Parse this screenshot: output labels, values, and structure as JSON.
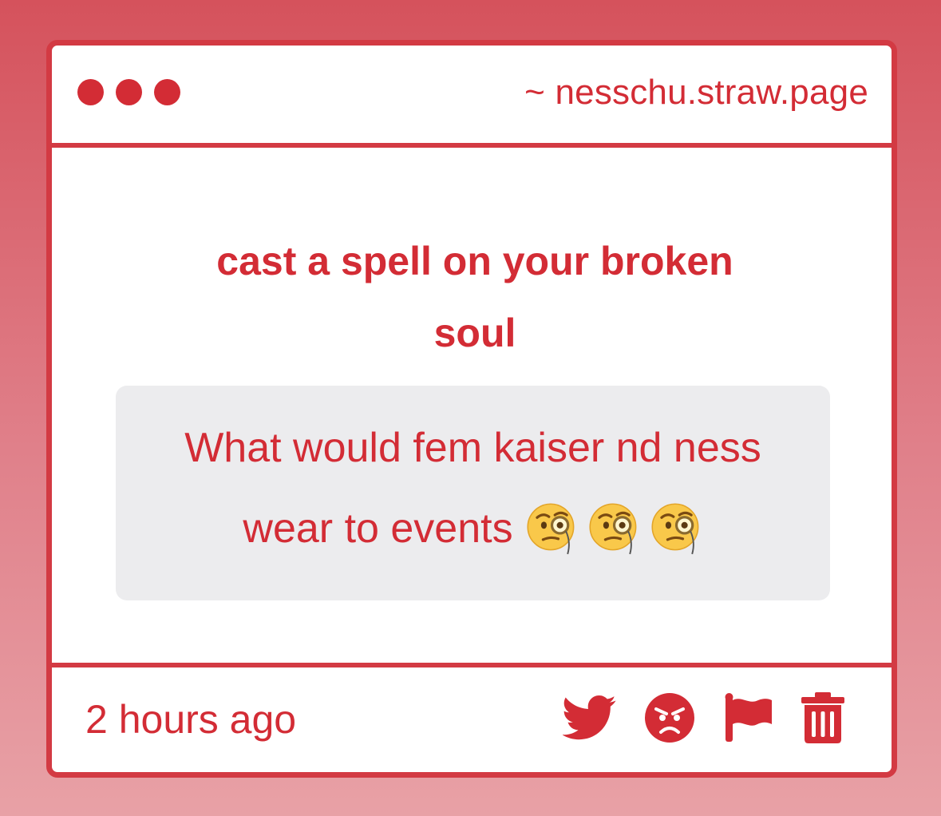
{
  "window": {
    "url": "~ nesschu.straw.page"
  },
  "post": {
    "prompt": "cast a spell on your broken soul",
    "message": "What would fem kaiser nd ness wear to events",
    "emojis": [
      "face-with-monocle",
      "face-with-monocle",
      "face-with-monocle"
    ]
  },
  "footer": {
    "timestamp": "2 hours ago",
    "actions": [
      "twitter-icon",
      "angry-face-icon",
      "flag-icon",
      "trash-icon"
    ]
  },
  "colors": {
    "accent": "#d32c35",
    "border": "#d33a43",
    "message_bg": "#ececee",
    "background_top": "#d5525c",
    "background_bottom": "#e8a1a6"
  }
}
